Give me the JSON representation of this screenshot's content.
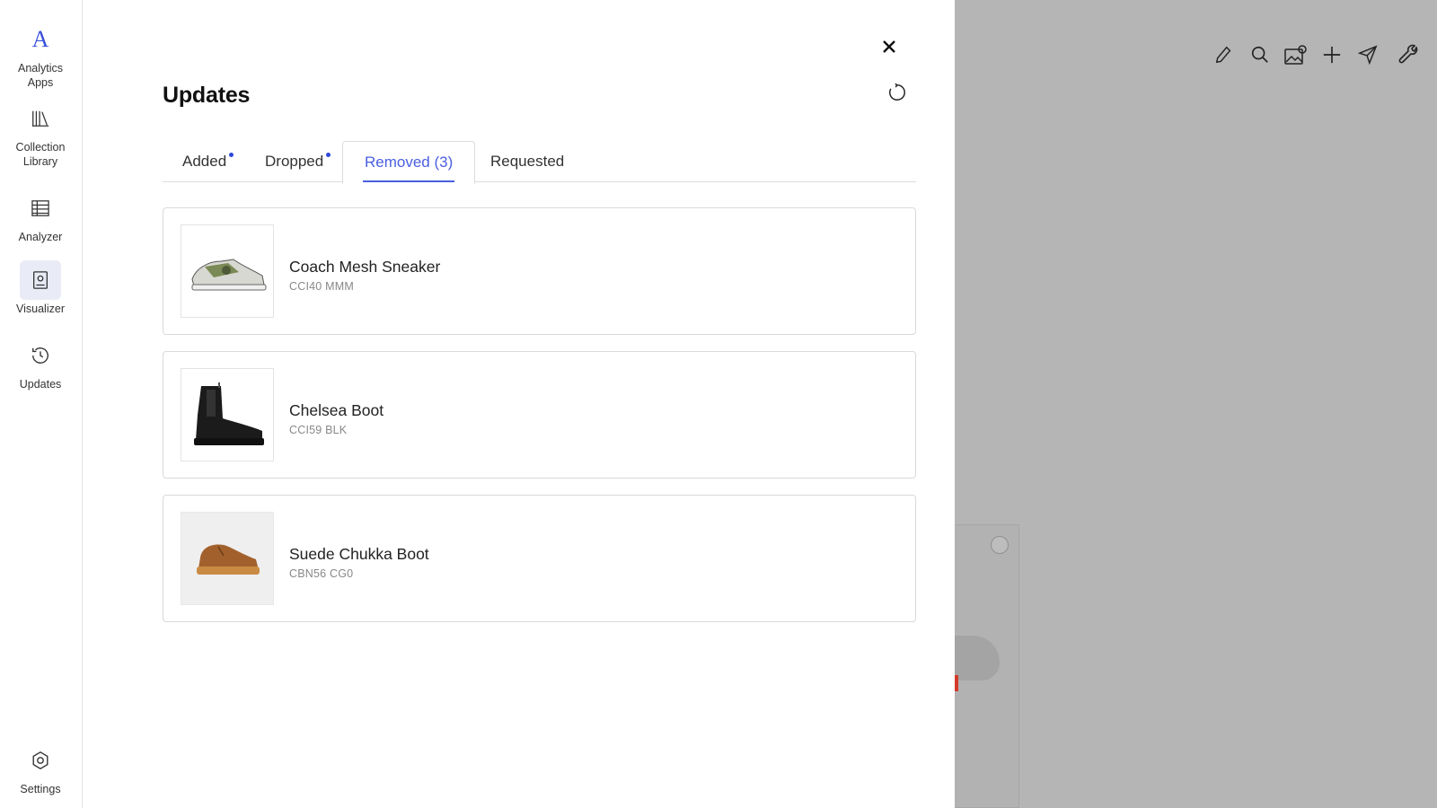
{
  "sidebar": {
    "logo": "A",
    "items": [
      {
        "label_line1": "Analytics",
        "label_line2": "Apps",
        "icon": "analytics-logo-icon"
      },
      {
        "label_line1": "Collection",
        "label_line2": "Library",
        "icon": "library-books-icon"
      },
      {
        "label_line1": "Analyzer",
        "label_line2": "",
        "icon": "table-grid-icon"
      },
      {
        "label_line1": "Visualizer",
        "label_line2": "",
        "icon": "document-portrait-icon"
      },
      {
        "label_line1": "Updates",
        "label_line2": "",
        "icon": "history-clock-icon"
      }
    ],
    "settings_label": "Settings"
  },
  "panel": {
    "title": "Updates",
    "tabs": [
      {
        "label": "Added",
        "has_dot": true
      },
      {
        "label": "Dropped",
        "has_dot": true
      },
      {
        "label": "Removed (3)",
        "active": true
      },
      {
        "label": "Requested"
      }
    ],
    "items": [
      {
        "name": "Coach Mesh Sneaker",
        "sku": "CCI40 MMM",
        "image": "sneaker"
      },
      {
        "name": "Chelsea Boot",
        "sku": "CCI59 BLK",
        "image": "chelsea-boot"
      },
      {
        "name": "Suede Chukka Boot",
        "sku": "CBN56 CG0",
        "image": "chukka-boot"
      }
    ]
  },
  "toolbar_icons": [
    "pencil-icon",
    "search-icon",
    "image-settings-icon",
    "plus-icon",
    "send-icon",
    "wrench-icon"
  ],
  "colors": {
    "accent": "#4a5fe0",
    "dot": "#2f48d8",
    "backdrop": "#b5b5b5"
  }
}
